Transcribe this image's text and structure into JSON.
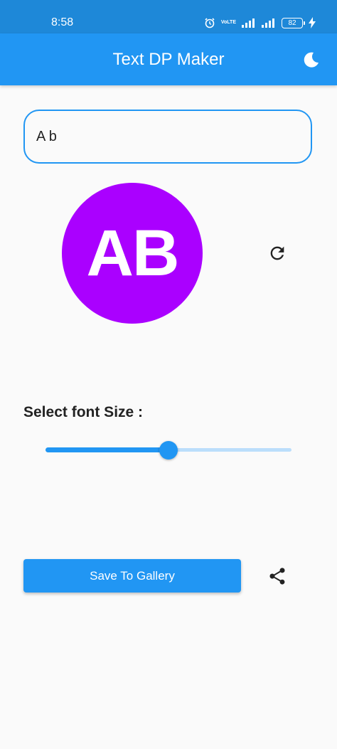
{
  "status_bar": {
    "time": "8:58",
    "network_label": "VoLTE",
    "battery": "82",
    "icons": [
      "alarm-icon",
      "volte-icon",
      "signal-icon",
      "signal-icon",
      "battery-icon",
      "charging-icon"
    ]
  },
  "app_bar": {
    "title": "Text DP Maker",
    "theme_icon": "moon-icon"
  },
  "input": {
    "value": "A b",
    "placeholder": ""
  },
  "preview": {
    "initials": "AB",
    "background_color": "#aa00ff",
    "text_color": "#ffffff",
    "refresh_icon": "refresh-icon"
  },
  "font_size": {
    "label": "Select font Size :",
    "slider_fraction": 0.5
  },
  "actions": {
    "save_label": "Save To Gallery",
    "share_icon": "share-icon"
  },
  "colors": {
    "status_bar": "#1e88d8",
    "primary": "#2196f3",
    "slider_inactive": "#bbdefb",
    "background": "#fafafa"
  }
}
